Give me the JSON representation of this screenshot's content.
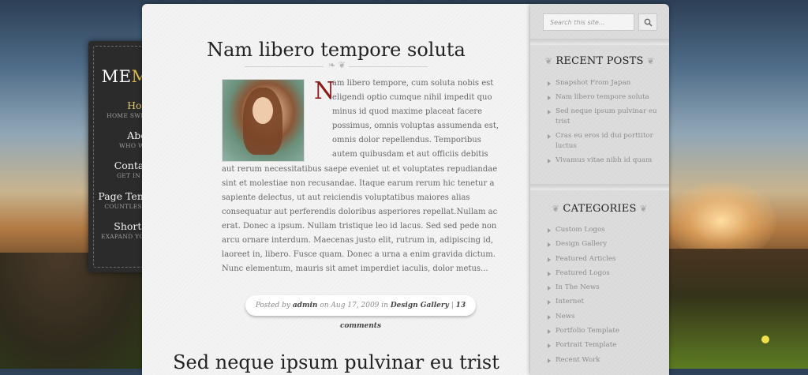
{
  "logo": {
    "part1": "ME",
    "part2": "MOIR"
  },
  "nav": {
    "items": [
      {
        "label": "Home",
        "sub": "HOME SWEET HOME"
      },
      {
        "label": "About",
        "sub": "WHO WE ARE"
      },
      {
        "label": "Contact Us",
        "sub": "GET IN TOUCH"
      },
      {
        "label": "Page Templates",
        "arrow": "»",
        "sub": "COUNTLESS CHOICES"
      },
      {
        "label": "Shortcodes",
        "sub": "EXAPAND YOUR DESIGN"
      }
    ]
  },
  "post": {
    "title": "Nam libero tempore soluta",
    "dropcap": "N",
    "body": "am libero tempore, cum soluta nobis est eligendi optio cumque nihil impedit quo minus id quod maxime placeat facere possimus, omnis voluptas assumenda est, omnis dolor repellendus. Temporibus autem quibusdam et aut officiis debitis aut rerum necessitatibus saepe eveniet ut et voluptates repudiandae sint et molestiae non recusandae. Itaque earum rerum hic tenetur a sapiente delectus, ut aut reiciendis voluptatibus maiores alias consequatur aut perferendis doloribus asperiores repellat.Nullam ac erat. Donec a ipsum. Nullam tristique leo id lacus. Sed sed pede non arcu ornare interdum. Maecenas justo elit, rutrum in, adipiscing id, laoreet in, libero. Fusce quam. Donec a urna a enim gravida dictum. Nunc elementum, mauris sit amet imperdiet iaculis, dolor metus...",
    "meta": {
      "posted_by": "Posted by",
      "author": "admin",
      "on": "on Aug 17, 2009 in",
      "category": "Design Gallery",
      "sep": "|",
      "comments": "13 comments"
    }
  },
  "post2": {
    "title": "Sed neque ipsum pulvinar eu trist"
  },
  "sidebar": {
    "search_placeholder": "Search this site...",
    "recent": {
      "title": "RECENT POSTS",
      "items": [
        "Snapshot From Japan",
        "Nam libero tempore soluta",
        "Sed neque ipsum pulvinar eu trist",
        "Cras eu eros id dui porttitor luctus",
        "Vivamus vitae nibh id quam"
      ]
    },
    "categories": {
      "title": "CATEGORIES",
      "items": [
        "Custom Logos",
        "Design Gallery",
        "Featured Articles",
        "Featured Logos",
        "In The News",
        "Internet",
        "News",
        "Portfolio Template",
        "Portrait Template",
        "Recent Work"
      ]
    }
  },
  "icons": {
    "search": "magnifier-icon",
    "ornament": "flourish-icon"
  },
  "colors": {
    "accent_gold": "#e1c86b",
    "dropcap_red": "#8b1a1a",
    "panel_dark": "#2b2b2b"
  }
}
